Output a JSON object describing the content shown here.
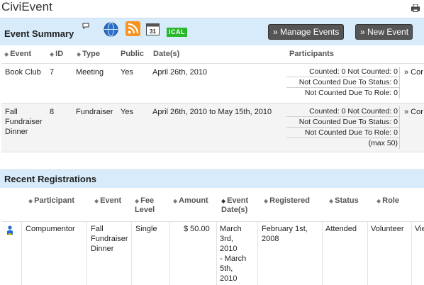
{
  "app_title": "CiviEvent",
  "event_summary": {
    "title": "Event Summary",
    "ical_label": "ICAL",
    "manage_button": "» Manage Events",
    "new_button": "» New Event",
    "columns": [
      "Event",
      "ID",
      "Type",
      "Public",
      "Date(s)",
      "Participants"
    ],
    "rows": [
      {
        "event": "Book Club",
        "id": "7",
        "type": "Meeting",
        "public": "Yes",
        "dates": "April 26th, 2010",
        "counted": "Counted: 0 Not Counted: 0",
        "not_status": "Not Counted Due To Status: 0",
        "not_role": "Not Counted Due To Role: 0",
        "link": "» Cor"
      },
      {
        "event_line1": "Fall",
        "event_line2": "Fundraiser",
        "event_line3": "Dinner",
        "id": "8",
        "type": "Fundraiser",
        "public": "Yes",
        "dates": "April 26th, 2010 to May 15th, 2010",
        "counted": "Counted: 0 Not Counted: 0",
        "not_status": "Not Counted Due To Status: 0",
        "not_role": "Not Counted Due To Role: 0",
        "max": "(max 50)",
        "link": "» Cor"
      }
    ]
  },
  "recent_registrations": {
    "title": "Recent Registrations",
    "columns": {
      "participant": "Participant",
      "event": "Event",
      "fee_level_1": "Fee",
      "fee_level_2": "Level",
      "amount": "Amount",
      "event_dates_1": "Event",
      "event_dates_2": "Date(s)",
      "registered": "Registered",
      "status": "Status",
      "role": "Role"
    },
    "row": {
      "participant": "Compumentor",
      "event_1": "Fall",
      "event_2": "Fundraiser",
      "event_3": "Dinner",
      "fee_level": "Single",
      "amount": "$ 50.00",
      "dates_1": "March",
      "dates_2": "3rd,",
      "dates_3": "2010",
      "dates_4": "- March",
      "dates_5": "5th,",
      "dates_6": "2010",
      "registered_1": "February 1st,",
      "registered_2": "2008",
      "status": "Attended",
      "role": "Volunteer",
      "link": "Vie"
    }
  },
  "icons": [
    "print-icon",
    "bubble-icon",
    "globe-icon",
    "rss-icon",
    "calendar-icon",
    "user-icon"
  ],
  "colors": {
    "header_bg": "#d7ebfa",
    "link": "#2a62b8",
    "button_bg": "#555555",
    "ical_green": "#29b72b"
  }
}
